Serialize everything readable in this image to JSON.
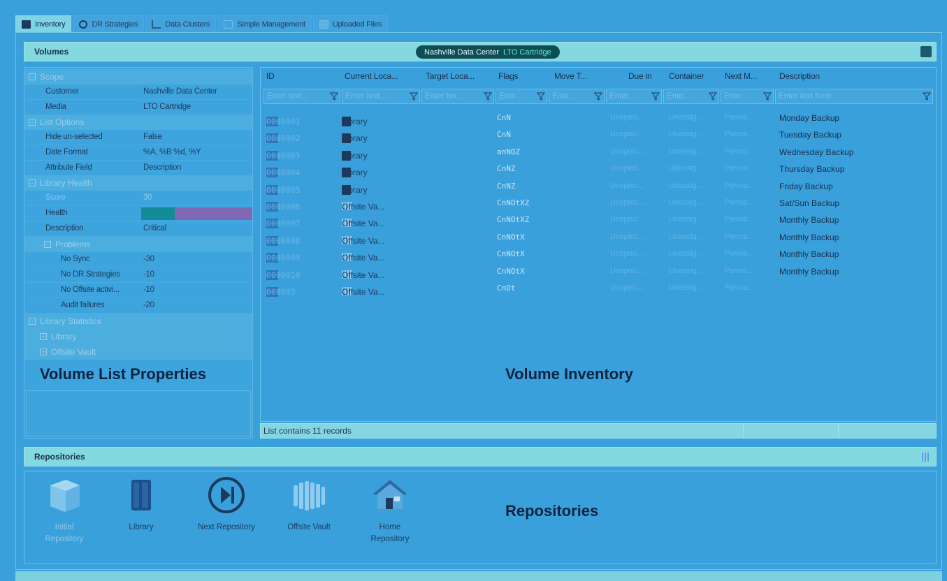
{
  "tabs": [
    {
      "label": "Inventory",
      "icon": "inventory-icon",
      "active": true
    },
    {
      "label": "DR Strategies",
      "icon": "dr-strategies-icon",
      "active": false
    },
    {
      "label": "Data Clusters",
      "icon": "data-clusters-icon",
      "active": false
    },
    {
      "label": "Simple Management",
      "icon": "simple-management-icon",
      "active": false
    },
    {
      "label": "Uploaded Files",
      "icon": "uploaded-files-icon",
      "active": false
    }
  ],
  "volumes": {
    "title": "Volumes",
    "pill_location": "Nashville Data Center",
    "pill_media": "LTO Cartridge"
  },
  "properties": {
    "scope": {
      "label": "Scope",
      "customer_key": "Customer",
      "customer_val": "Nashville Data Center",
      "media_key": "Media",
      "media_val": "LTO Cartridge"
    },
    "list_options": {
      "label": "List Options",
      "hide_key": "Hide un-selected",
      "hide_val": "False",
      "date_key": "Date Format",
      "date_val": "%A, %B %d, %Y",
      "attr_key": "Attribute Field",
      "attr_val": "Description"
    },
    "library_health": {
      "label": "Library Health",
      "score_key": "Score",
      "score_val": "30",
      "health_key": "Health",
      "desc_key": "Description",
      "desc_val": "Critical",
      "problems": {
        "label": "Problems",
        "items": [
          {
            "k": "No Sync",
            "v": "-30"
          },
          {
            "k": "No DR Strategies",
            "v": "-10"
          },
          {
            "k": "No Offsite activi...",
            "v": "-10"
          },
          {
            "k": "Audit failures",
            "v": "-20"
          }
        ]
      }
    },
    "library_statistics": {
      "label": "Library Statistics",
      "library": "Library",
      "offsite": "Offsite Vault"
    },
    "caption": "Volume List Properties"
  },
  "grid": {
    "columns": [
      {
        "label": "ID",
        "filter": "Enter text..."
      },
      {
        "label": "Current Loca...",
        "filter": "Enter text..."
      },
      {
        "label": "Target Loca...",
        "filter": "Enter tex..."
      },
      {
        "label": "Flags",
        "filter": "Ente..."
      },
      {
        "label": "Move T...",
        "filter": "Ente..."
      },
      {
        "label": "Due in",
        "filter": "Enter..."
      },
      {
        "label": "Container",
        "filter": "Ente..."
      },
      {
        "label": "Next M...",
        "filter": "Ente..."
      },
      {
        "label": "Description",
        "filter": "Enter text here"
      }
    ],
    "rows": [
      {
        "id": "0000001",
        "loc": "Library",
        "loc_type": "library",
        "flags": "CnN",
        "due": "Unspeci...",
        "container": "Unassig...",
        "next": "Perma...",
        "desc": "Monday Backup"
      },
      {
        "id": "0000002",
        "loc": "Library",
        "loc_type": "library",
        "flags": "CnN",
        "due": "Unspeci...",
        "container": "Unassig...",
        "next": "Perma...",
        "desc": "Tuesday Backup"
      },
      {
        "id": "0000003",
        "loc": "Library",
        "loc_type": "library",
        "flags": "anNOZ",
        "due": "Unspeci...",
        "container": "Unassig...",
        "next": "Perma...",
        "desc": "Wednesday Backup"
      },
      {
        "id": "0000004",
        "loc": "Library",
        "loc_type": "library",
        "flags": "CnNZ",
        "due": "Unspeci...",
        "container": "Unassig...",
        "next": "Perma...",
        "desc": "Thursday Backup"
      },
      {
        "id": "0000005",
        "loc": "Library",
        "loc_type": "library",
        "flags": "CnNZ",
        "due": "Unspeci...",
        "container": "Unassig...",
        "next": "Perma...",
        "desc": "Friday Backup"
      },
      {
        "id": "0000006",
        "loc": "Offsite Va...",
        "loc_type": "vault",
        "flags": "CnNOtXZ",
        "due": "Unspeci...",
        "container": "Unassig...",
        "next": "Perma...",
        "desc": "Sat/Sun Backup"
      },
      {
        "id": "0000007",
        "loc": "Offsite Va...",
        "loc_type": "vault",
        "flags": "CnNOtXZ",
        "due": "Unspeci...",
        "container": "Unassig...",
        "next": "Perma...",
        "desc": "Monthly Backup"
      },
      {
        "id": "0000008",
        "loc": "Offsite Va...",
        "loc_type": "vault",
        "flags": "CnNOtX",
        "due": "Unspeci...",
        "container": "Unassig...",
        "next": "Perma...",
        "desc": "Monthly Backup"
      },
      {
        "id": "0000009",
        "loc": "Offsite Va...",
        "loc_type": "vault",
        "flags": "CnNOtX",
        "due": "Unspeci...",
        "container": "Unassig...",
        "next": "Perma...",
        "desc": "Monthly Backup"
      },
      {
        "id": "0000010",
        "loc": "Offsite Va...",
        "loc_type": "vault",
        "flags": "CnNOtX",
        "due": "Unspeci...",
        "container": "Unassig...",
        "next": "Perma...",
        "desc": "Monthly Backup"
      },
      {
        "id": "000003",
        "loc": "Offsite Va...",
        "loc_type": "vault",
        "flags": "CnOt",
        "due": "Unspeci...",
        "container": "Unassig...",
        "next": "Perma...",
        "desc": ""
      }
    ],
    "caption": "Volume Inventory",
    "status": "List contains 11 records"
  },
  "repositories": {
    "title": "Repositories",
    "caption": "Repositories",
    "items": [
      {
        "label_line1": "Initial",
        "label_line2": "Repository",
        "icon": "initial-repository-icon"
      },
      {
        "label_line1": "Library",
        "label_line2": "",
        "icon": "library-icon"
      },
      {
        "label_line1": "Next Repository",
        "label_line2": "",
        "icon": "next-repository-icon"
      },
      {
        "label_line1": "Offsite Vault",
        "label_line2": "",
        "icon": "offsite-vault-icon"
      },
      {
        "label_line1": "Home",
        "label_line2": "Repository",
        "icon": "home-repository-icon"
      }
    ]
  },
  "colors": {
    "background": "#3aa0dc",
    "header_band": "#84d8e0",
    "pill": "#0e4d55",
    "health_good": "#128b97",
    "health_bad": "#7e6ab3"
  }
}
